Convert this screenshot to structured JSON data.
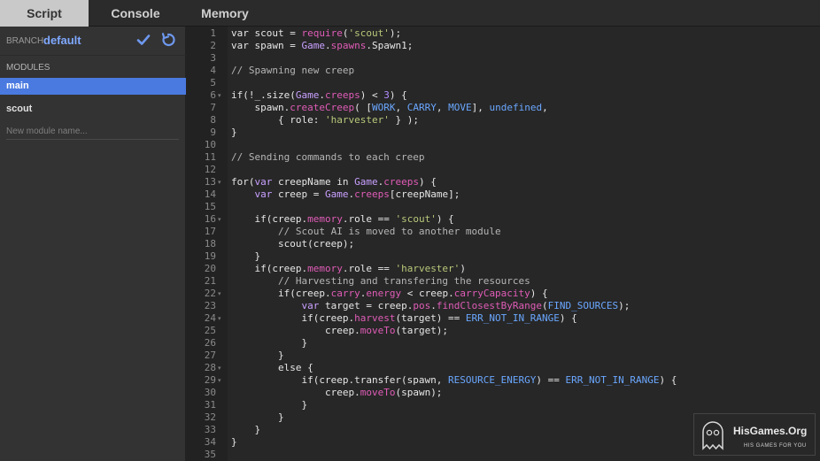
{
  "tabs": [
    {
      "label": "Script",
      "active": true
    },
    {
      "label": "Console",
      "active": false
    },
    {
      "label": "Memory",
      "active": false
    }
  ],
  "sidebar": {
    "branch_label": "BRANCH:",
    "branch_value": "default",
    "modules_label": "MODULES",
    "modules": [
      {
        "label": "main",
        "active": true
      },
      {
        "label": "scout",
        "active": false
      }
    ],
    "new_module_placeholder": "New module name..."
  },
  "editor": {
    "lines": [
      {
        "n": "1",
        "fold": false,
        "segs": [
          [
            "kw",
            "var scout = "
          ],
          [
            "fn",
            "require"
          ],
          [
            "kw",
            "("
          ],
          [
            "str",
            "'scout'"
          ],
          [
            "kw",
            ");"
          ]
        ]
      },
      {
        "n": "2",
        "fold": false,
        "segs": [
          [
            "kw",
            "var spawn = "
          ],
          [
            "game",
            "Game"
          ],
          [
            "kw",
            "."
          ],
          [
            "prop",
            "spawns"
          ],
          [
            "kw",
            ".Spawn1;"
          ]
        ]
      },
      {
        "n": "3",
        "fold": false,
        "segs": []
      },
      {
        "n": "4",
        "fold": false,
        "segs": [
          [
            "cmt",
            "// Spawning new creep"
          ]
        ]
      },
      {
        "n": "5",
        "fold": false,
        "segs": []
      },
      {
        "n": "6",
        "fold": true,
        "segs": [
          [
            "kw",
            "if(!_.size("
          ],
          [
            "game",
            "Game"
          ],
          [
            "kw",
            "."
          ],
          [
            "prop",
            "creeps"
          ],
          [
            "kw",
            ") < "
          ],
          [
            "num",
            "3"
          ],
          [
            "kw",
            ") {"
          ]
        ]
      },
      {
        "n": "7",
        "fold": false,
        "segs": [
          [
            "kw",
            "    spawn."
          ],
          [
            "fn",
            "createCreep"
          ],
          [
            "kw",
            "( ["
          ],
          [
            "const",
            "WORK"
          ],
          [
            "kw",
            ", "
          ],
          [
            "const",
            "CARRY"
          ],
          [
            "kw",
            ", "
          ],
          [
            "const",
            "MOVE"
          ],
          [
            "kw",
            "], "
          ],
          [
            "const",
            "undefined"
          ],
          [
            "kw",
            ","
          ]
        ]
      },
      {
        "n": "8",
        "fold": false,
        "segs": [
          [
            "kw",
            "        { role: "
          ],
          [
            "str",
            "'harvester'"
          ],
          [
            "kw",
            " } );"
          ]
        ]
      },
      {
        "n": "9",
        "fold": false,
        "segs": [
          [
            "kw",
            "}"
          ]
        ]
      },
      {
        "n": "10",
        "fold": false,
        "segs": []
      },
      {
        "n": "11",
        "fold": false,
        "segs": [
          [
            "cmt",
            "// Sending commands to each creep"
          ]
        ]
      },
      {
        "n": "12",
        "fold": false,
        "segs": []
      },
      {
        "n": "13",
        "fold": true,
        "segs": [
          [
            "kw",
            "for("
          ],
          [
            "var",
            "var"
          ],
          [
            "kw",
            " creepName in "
          ],
          [
            "game",
            "Game"
          ],
          [
            "kw",
            "."
          ],
          [
            "prop",
            "creeps"
          ],
          [
            "kw",
            ") {"
          ]
        ]
      },
      {
        "n": "14",
        "fold": false,
        "segs": [
          [
            "kw",
            "    "
          ],
          [
            "var",
            "var"
          ],
          [
            "kw",
            " creep = "
          ],
          [
            "game",
            "Game"
          ],
          [
            "kw",
            "."
          ],
          [
            "prop",
            "creeps"
          ],
          [
            "kw",
            "[creepName];"
          ]
        ]
      },
      {
        "n": "15",
        "fold": false,
        "segs": []
      },
      {
        "n": "16",
        "fold": true,
        "segs": [
          [
            "kw",
            "    if(creep."
          ],
          [
            "prop",
            "memory"
          ],
          [
            "kw",
            ".role == "
          ],
          [
            "str",
            "'scout'"
          ],
          [
            "kw",
            ") {"
          ]
        ]
      },
      {
        "n": "17",
        "fold": false,
        "segs": [
          [
            "cmt",
            "        // Scout AI is moved to another module"
          ]
        ]
      },
      {
        "n": "18",
        "fold": false,
        "segs": [
          [
            "kw",
            "        scout(creep);"
          ]
        ]
      },
      {
        "n": "19",
        "fold": false,
        "segs": [
          [
            "kw",
            "    }"
          ]
        ]
      },
      {
        "n": "20",
        "fold": false,
        "segs": [
          [
            "kw",
            "    if(creep."
          ],
          [
            "prop",
            "memory"
          ],
          [
            "kw",
            ".role == "
          ],
          [
            "str",
            "'harvester'"
          ],
          [
            "kw",
            ")"
          ]
        ]
      },
      {
        "n": "21",
        "fold": false,
        "segs": [
          [
            "cmt",
            "        // Harvesting and transfering the resources"
          ]
        ]
      },
      {
        "n": "22",
        "fold": true,
        "segs": [
          [
            "kw",
            "        if(creep."
          ],
          [
            "prop",
            "carry"
          ],
          [
            "kw",
            "."
          ],
          [
            "prop",
            "energy"
          ],
          [
            "kw",
            " < creep."
          ],
          [
            "prop",
            "carryCapacity"
          ],
          [
            "kw",
            ") {"
          ]
        ]
      },
      {
        "n": "23",
        "fold": false,
        "segs": [
          [
            "kw",
            "            "
          ],
          [
            "var",
            "var"
          ],
          [
            "kw",
            " target = creep."
          ],
          [
            "prop",
            "pos"
          ],
          [
            "kw",
            "."
          ],
          [
            "fn",
            "findClosestByRange"
          ],
          [
            "kw",
            "("
          ],
          [
            "const",
            "FIND_SOURCES"
          ],
          [
            "kw",
            ");"
          ]
        ]
      },
      {
        "n": "24",
        "fold": true,
        "segs": [
          [
            "kw",
            "            if(creep."
          ],
          [
            "fn",
            "harvest"
          ],
          [
            "kw",
            "(target) == "
          ],
          [
            "const",
            "ERR_NOT_IN_RANGE"
          ],
          [
            "kw",
            ") {"
          ]
        ]
      },
      {
        "n": "25",
        "fold": false,
        "segs": [
          [
            "kw",
            "                creep."
          ],
          [
            "fn",
            "moveTo"
          ],
          [
            "kw",
            "(target);"
          ]
        ]
      },
      {
        "n": "26",
        "fold": false,
        "segs": [
          [
            "kw",
            "            }"
          ]
        ]
      },
      {
        "n": "27",
        "fold": false,
        "segs": [
          [
            "kw",
            "        }"
          ]
        ]
      },
      {
        "n": "28",
        "fold": true,
        "segs": [
          [
            "kw",
            "        else {"
          ]
        ]
      },
      {
        "n": "29",
        "fold": true,
        "segs": [
          [
            "kw",
            "            if(creep.transfer(spawn, "
          ],
          [
            "const",
            "RESOURCE_ENERGY"
          ],
          [
            "kw",
            ") == "
          ],
          [
            "const",
            "ERR_NOT_IN_RANGE"
          ],
          [
            "kw",
            ") {"
          ]
        ]
      },
      {
        "n": "30",
        "fold": false,
        "segs": [
          [
            "kw",
            "                creep."
          ],
          [
            "fn",
            "moveTo"
          ],
          [
            "kw",
            "(spawn);"
          ]
        ]
      },
      {
        "n": "31",
        "fold": false,
        "segs": [
          [
            "kw",
            "            }"
          ]
        ]
      },
      {
        "n": "32",
        "fold": false,
        "segs": [
          [
            "kw",
            "        }"
          ]
        ]
      },
      {
        "n": "33",
        "fold": false,
        "segs": [
          [
            "kw",
            "    }"
          ]
        ]
      },
      {
        "n": "34",
        "fold": false,
        "segs": [
          [
            "kw",
            "}"
          ]
        ]
      },
      {
        "n": "35",
        "fold": false,
        "segs": []
      }
    ]
  },
  "watermark": {
    "title": "HisGames.Org",
    "subtitle": "HIS GAMES FOR YOU"
  },
  "colors": {
    "accent": "#4a7ae0",
    "branch": "#7fa8ff",
    "string": "#b8c87a",
    "function": "#e05cb7",
    "constant": "#6aa7ff",
    "number": "#b48cff"
  },
  "icons": [
    "check-icon",
    "refresh-icon",
    "fold-arrow-icon",
    "ghost-logo-icon"
  ]
}
